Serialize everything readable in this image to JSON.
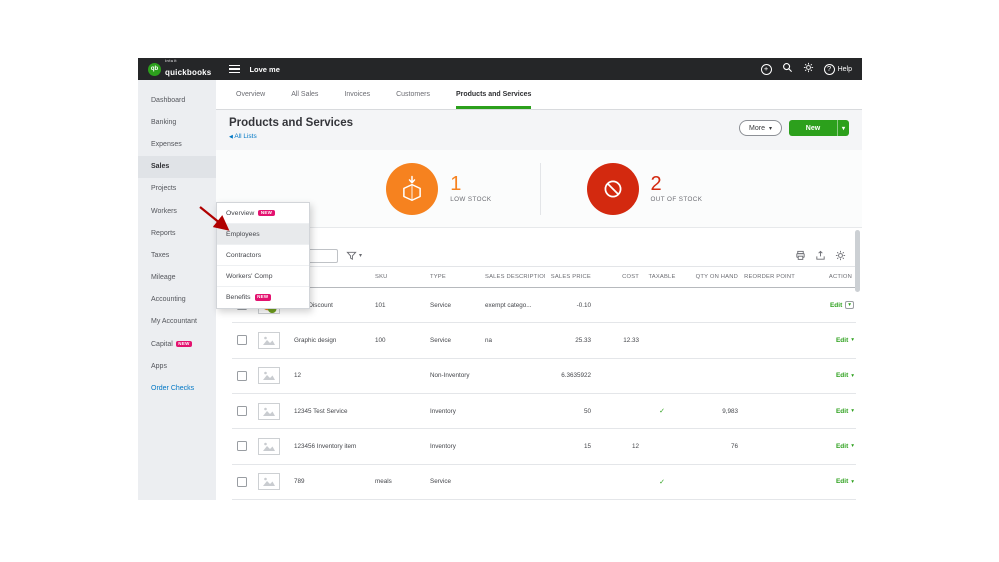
{
  "colors": {
    "accent_green": "#2ca01c",
    "link_blue": "#0077c5",
    "low_stock_orange": "#f6821f",
    "out_of_stock_red": "#d3290f",
    "badge_pink": "#e3126f",
    "topbar_black": "#252628"
  },
  "glyphs": {
    "caret": "▾",
    "back_chevron": "◀"
  },
  "header": {
    "brand_top": "intuit",
    "brand": "quickbooks",
    "logo_monogram": "qb",
    "company": "Love me",
    "help": "Help"
  },
  "sidebar": {
    "items": [
      {
        "label": "Dashboard"
      },
      {
        "label": "Banking"
      },
      {
        "label": "Expenses"
      },
      {
        "label": "Sales"
      },
      {
        "label": "Projects"
      },
      {
        "label": "Workers"
      },
      {
        "label": "Reports"
      },
      {
        "label": "Taxes"
      },
      {
        "label": "Mileage"
      },
      {
        "label": "Accounting"
      },
      {
        "label": "My Accountant"
      },
      {
        "label": "Capital",
        "badge": "NEW"
      },
      {
        "label": "Apps"
      },
      {
        "label": "Order Checks"
      }
    ]
  },
  "workers_menu": {
    "items": [
      {
        "label": "Overview",
        "badge": "NEW"
      },
      {
        "label": "Employees"
      },
      {
        "label": "Contractors"
      },
      {
        "label": "Workers' Comp"
      },
      {
        "label": "Benefits",
        "badge": "NEW"
      }
    ]
  },
  "tabs": {
    "items": [
      {
        "label": "Overview"
      },
      {
        "label": "All Sales"
      },
      {
        "label": "Invoices"
      },
      {
        "label": "Customers"
      },
      {
        "label": "Products and Services"
      }
    ]
  },
  "page": {
    "title": "Products and Services",
    "back_link": "All Lists",
    "more": "More",
    "new": "New"
  },
  "tiles": {
    "low_stock": {
      "count": "1",
      "label": "LOW STOCK"
    },
    "out_of_stock": {
      "count": "2",
      "label": "OUT OF STOCK"
    }
  },
  "table": {
    "headers": {
      "sku": "SKU",
      "type": "TYPE",
      "desc": "SALES DESCRIPTION",
      "price": "SALES PRICE",
      "cost": "COST",
      "taxable": "TAXABLE",
      "qty": "QTY ON HAND",
      "reorder": "REORDER POINT",
      "action": "ACTION"
    },
    "rows": [
      {
        "name": "10% Discount",
        "sku": "101",
        "type": "Service",
        "desc": "exempt catego...",
        "price": "-0.10",
        "cost": "",
        "taxable": "",
        "qty": "",
        "reorder": "",
        "action": "Edit"
      },
      {
        "name": "Graphic design",
        "sku": "100",
        "type": "Service",
        "desc": "na",
        "price": "25.33",
        "cost": "12.33",
        "taxable": "",
        "qty": "",
        "reorder": "",
        "action": "Edit"
      },
      {
        "name": "12",
        "sku": "",
        "type": "Non-Inventory",
        "desc": "",
        "price": "6.3635922",
        "cost": "",
        "taxable": "",
        "qty": "",
        "reorder": "",
        "action": "Edit"
      },
      {
        "name": "12345 Test Service",
        "sku": "",
        "type": "Inventory",
        "desc": "",
        "price": "50",
        "cost": "",
        "taxable": "✓",
        "qty": "9,983",
        "reorder": "",
        "action": "Edit"
      },
      {
        "name": "123456 Inventory item",
        "sku": "",
        "type": "Inventory",
        "desc": "",
        "price": "15",
        "cost": "12",
        "taxable": "",
        "qty": "76",
        "reorder": "",
        "action": "Edit"
      },
      {
        "name": "789",
        "sku": "meals",
        "type": "Service",
        "desc": "",
        "price": "",
        "cost": "",
        "taxable": "✓",
        "qty": "",
        "reorder": "",
        "action": "Edit"
      }
    ]
  }
}
